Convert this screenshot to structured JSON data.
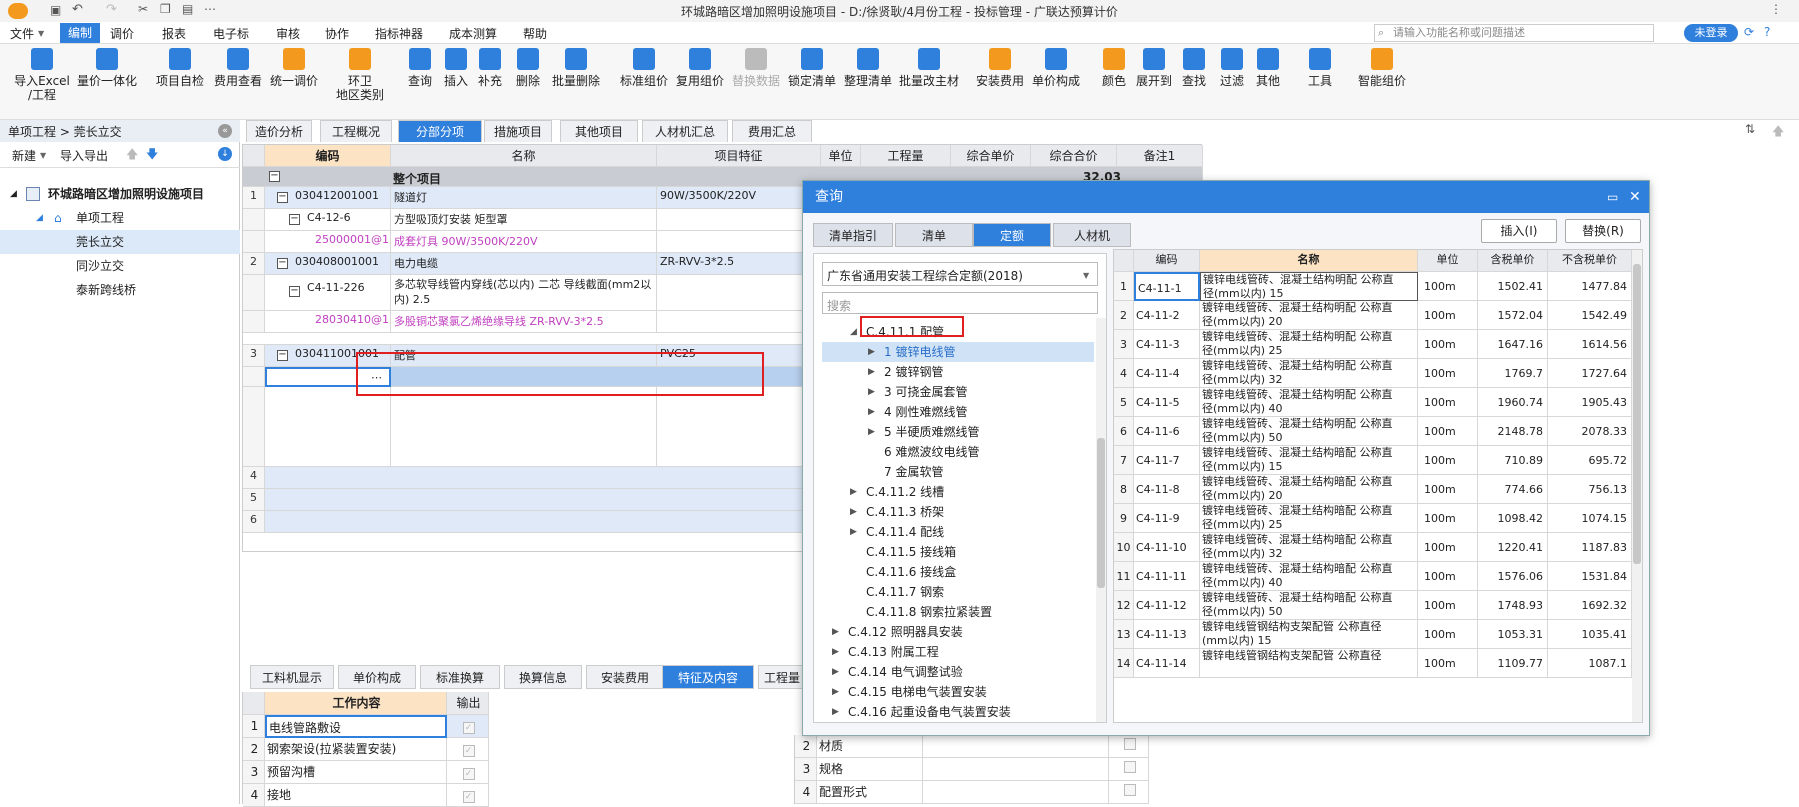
{
  "window_title": "环城路暗区增加照明设施项目 - D:/徐贤耿/4月份工程 - 投标管理 - 广联达预算计价",
  "menu": [
    "文件",
    "编制",
    "调价",
    "报表",
    "电子标",
    "审核",
    "协作",
    "指标神器",
    "成本测算",
    "帮助"
  ],
  "search_placeholder": "请输入功能名称或问题描述",
  "login_label": "未登录",
  "toolbar": [
    {
      "label": "导入Excel\n/工程",
      "icon": "import-excel-icon"
    },
    {
      "label": "量价一体化",
      "icon": "quantity-price-icon"
    },
    {
      "label": "项目自检",
      "icon": "self-check-icon"
    },
    {
      "label": "费用查看",
      "icon": "fee-view-icon"
    },
    {
      "label": "统一调价",
      "icon": "adjust-price-icon"
    },
    {
      "label": "环卫\n地区类别",
      "icon": "region-category-icon"
    },
    {
      "label": "查询",
      "icon": "query-icon"
    },
    {
      "label": "插入",
      "icon": "insert-icon"
    },
    {
      "label": "补充",
      "icon": "supplement-icon"
    },
    {
      "label": "删除",
      "icon": "delete-icon"
    },
    {
      "label": "批量删除",
      "icon": "batch-delete-icon"
    },
    {
      "label": "标准组价",
      "icon": "standard-price-icon"
    },
    {
      "label": "复用组价",
      "icon": "reuse-price-icon"
    },
    {
      "label": "替换数据",
      "icon": "replace-data-icon"
    },
    {
      "label": "锁定清单",
      "icon": "lock-icon"
    },
    {
      "label": "整理清单",
      "icon": "arrange-list-icon"
    },
    {
      "label": "批量改主材",
      "icon": "batch-material-icon"
    },
    {
      "label": "安装费用",
      "icon": "install-fee-icon"
    },
    {
      "label": "单价构成",
      "icon": "unit-price-icon"
    },
    {
      "label": "颜色",
      "icon": "color-icon"
    },
    {
      "label": "展开到",
      "icon": "expand-icon"
    },
    {
      "label": "查找",
      "icon": "find-icon"
    },
    {
      "label": "过滤",
      "icon": "filter-icon"
    },
    {
      "label": "其他",
      "icon": "other-icon"
    },
    {
      "label": "工具",
      "icon": "tools-icon"
    },
    {
      "label": "智能组价",
      "icon": "smart-price-icon"
    }
  ],
  "left": {
    "breadcrumb": "单项工程 > 莞长立交",
    "new_label": "新建",
    "import_export_label": "导入导出",
    "tree": [
      "环城路暗区增加照明设施项目",
      "单项工程",
      "莞长立交",
      "同沙立交",
      "泰新跨线桥"
    ]
  },
  "center_tabs": [
    "造价分析",
    "工程概况",
    "分部分项",
    "措施项目",
    "其他项目",
    "人材机汇总",
    "费用汇总"
  ],
  "grid": {
    "headers": [
      "编码",
      "名称",
      "项目特征",
      "单位",
      "工程量",
      "综合单价",
      "综合合价",
      "备注1"
    ],
    "whole_project": "整个项目",
    "whole_total": "32.03",
    "rows": [
      {
        "num": "1",
        "code": "030412001001",
        "name": "隧道灯",
        "feature": "90W/3500K/220V"
      },
      {
        "num": "",
        "code": "C4-12-6",
        "name": "方型吸顶灯安装 矩型罩",
        "feature": ""
      },
      {
        "num": "",
        "code": "25000001@1",
        "name": "成套灯具 90W/3500K/220V",
        "feature": ""
      },
      {
        "num": "2",
        "code": "030408001001",
        "name": "电力电缆",
        "feature": "ZR-RVV-3*2.5"
      },
      {
        "num": "",
        "code": "C4-11-226",
        "name": "多芯软导线管内穿线(芯以内) 二芯 导线截面(mm2以内) 2.5",
        "feature": ""
      },
      {
        "num": "",
        "code": "28030410@1",
        "name": "多股铜芯聚氯乙烯绝缘导线 ZR-RVV-3*2.5",
        "feature": ""
      },
      {
        "num": "3",
        "code": "030411001001",
        "name": "配管",
        "feature": "PVC25"
      }
    ],
    "empty_rows": [
      "4",
      "5",
      "6"
    ]
  },
  "bottom_tabs": [
    "工料机显示",
    "单价构成",
    "标准换算",
    "换算信息",
    "安装费用",
    "特征及内容",
    "工程量"
  ],
  "work_content": {
    "headers": [
      "工作内容",
      "输出"
    ],
    "rows": [
      {
        "num": "1",
        "text": "电线管路敷设"
      },
      {
        "num": "2",
        "text": "钢索架设(拉紧装置安装)"
      },
      {
        "num": "3",
        "text": "预留沟槽"
      },
      {
        "num": "4",
        "text": "接地"
      }
    ]
  },
  "features": {
    "rows": [
      {
        "num": "2",
        "text": "材质"
      },
      {
        "num": "3",
        "text": "规格"
      },
      {
        "num": "4",
        "text": "配置形式"
      }
    ]
  },
  "dialog": {
    "title": "查询",
    "tabs": [
      "清单指引",
      "清单",
      "定额",
      "人材机"
    ],
    "insert_label": "插入(I)",
    "replace_label": "替换(R)",
    "quota_select": "广东省通用安装工程综合定额(2018)",
    "search_placeholder": "搜索",
    "tree": [
      {
        "text": "C.4.11.1 配管",
        "level": 2,
        "expander": "open"
      },
      {
        "text": "1 镀锌电线管",
        "level": 3,
        "expander": "closed",
        "selected": true
      },
      {
        "text": "2 镀锌钢管",
        "level": 3,
        "expander": "closed"
      },
      {
        "text": "3 可挠金属套管",
        "level": 3,
        "expander": "closed"
      },
      {
        "text": "4 刚性难燃线管",
        "level": 3,
        "expander": "closed"
      },
      {
        "text": "5 半硬质难燃线管",
        "level": 3,
        "expander": "closed"
      },
      {
        "text": "6 难燃波纹电线管",
        "level": 3,
        "expander": ""
      },
      {
        "text": "7 金属软管",
        "level": 3,
        "expander": ""
      },
      {
        "text": "C.4.11.2 线槽",
        "level": 2,
        "expander": "closed"
      },
      {
        "text": "C.4.11.3 桥架",
        "level": 2,
        "expander": "closed"
      },
      {
        "text": "C.4.11.4 配线",
        "level": 2,
        "expander": "closed"
      },
      {
        "text": "C.4.11.5 接线箱",
        "level": 2,
        "expander": ""
      },
      {
        "text": "C.4.11.6 接线盒",
        "level": 2,
        "expander": ""
      },
      {
        "text": "C.4.11.7 钢索",
        "level": 2,
        "expander": ""
      },
      {
        "text": "C.4.11.8 钢索拉紧装置",
        "level": 2,
        "expander": ""
      },
      {
        "text": "C.4.12 照明器具安装",
        "level": 1,
        "expander": "closed"
      },
      {
        "text": "C.4.13 附属工程",
        "level": 1,
        "expander": "closed"
      },
      {
        "text": "C.4.14 电气调整试验",
        "level": 1,
        "expander": "closed"
      },
      {
        "text": "C.4.15 电梯电气装置安装",
        "level": 1,
        "expander": "closed"
      },
      {
        "text": "C.4.16 起重设备电气装置安装",
        "level": 1,
        "expander": "closed"
      }
    ],
    "headers": [
      "编码",
      "名称",
      "单位",
      "含税单价",
      "不含税单价"
    ],
    "rows": [
      {
        "num": "1",
        "code": "C4-11-1",
        "name1": "镀锌电线管砖、混凝土结构明配 公称直",
        "name2": "径(mm以内) 15",
        "unit": "100m",
        "tax": "1502.41",
        "notax": "1477.84"
      },
      {
        "num": "2",
        "code": "C4-11-2",
        "name1": "镀锌电线管砖、混凝土结构明配 公称直",
        "name2": "径(mm以内) 20",
        "unit": "100m",
        "tax": "1572.04",
        "notax": "1542.49"
      },
      {
        "num": "3",
        "code": "C4-11-3",
        "name1": "镀锌电线管砖、混凝土结构明配 公称直",
        "name2": "径(mm以内) 25",
        "unit": "100m",
        "tax": "1647.16",
        "notax": "1614.56"
      },
      {
        "num": "4",
        "code": "C4-11-4",
        "name1": "镀锌电线管砖、混凝土结构明配 公称直",
        "name2": "径(mm以内) 32",
        "unit": "100m",
        "tax": "1769.7",
        "notax": "1727.64"
      },
      {
        "num": "5",
        "code": "C4-11-5",
        "name1": "镀锌电线管砖、混凝土结构明配 公称直",
        "name2": "径(mm以内) 40",
        "unit": "100m",
        "tax": "1960.74",
        "notax": "1905.43"
      },
      {
        "num": "6",
        "code": "C4-11-6",
        "name1": "镀锌电线管砖、混凝土结构明配 公称直",
        "name2": "径(mm以内) 50",
        "unit": "100m",
        "tax": "2148.78",
        "notax": "2078.33"
      },
      {
        "num": "7",
        "code": "C4-11-7",
        "name1": "镀锌电线管砖、混凝土结构暗配 公称直",
        "name2": "径(mm以内) 15",
        "unit": "100m",
        "tax": "710.89",
        "notax": "695.72"
      },
      {
        "num": "8",
        "code": "C4-11-8",
        "name1": "镀锌电线管砖、混凝土结构暗配 公称直",
        "name2": "径(mm以内) 20",
        "unit": "100m",
        "tax": "774.66",
        "notax": "756.13"
      },
      {
        "num": "9",
        "code": "C4-11-9",
        "name1": "镀锌电线管砖、混凝土结构暗配 公称直",
        "name2": "径(mm以内) 25",
        "unit": "100m",
        "tax": "1098.42",
        "notax": "1074.15"
      },
      {
        "num": "10",
        "code": "C4-11-10",
        "name1": "镀锌电线管砖、混凝土结构暗配 公称直",
        "name2": "径(mm以内) 32",
        "unit": "100m",
        "tax": "1220.41",
        "notax": "1187.83"
      },
      {
        "num": "11",
        "code": "C4-11-11",
        "name1": "镀锌电线管砖、混凝土结构暗配 公称直",
        "name2": "径(mm以内) 40",
        "unit": "100m",
        "tax": "1576.06",
        "notax": "1531.84"
      },
      {
        "num": "12",
        "code": "C4-11-12",
        "name1": "镀锌电线管砖、混凝土结构暗配 公称直",
        "name2": "径(mm以内) 50",
        "unit": "100m",
        "tax": "1748.93",
        "notax": "1692.32"
      },
      {
        "num": "13",
        "code": "C4-11-13",
        "name1": "镀锌电线管钢结构支架配管 公称直径",
        "name2": "(mm以内) 15",
        "unit": "100m",
        "tax": "1053.31",
        "notax": "1035.41"
      },
      {
        "num": "14",
        "code": "C4-11-14",
        "name1": "镀锌电线管钢结构支架配管 公称直径",
        "name2": "",
        "unit": "100m",
        "tax": "1109.77",
        "notax": "1087.1"
      }
    ]
  }
}
